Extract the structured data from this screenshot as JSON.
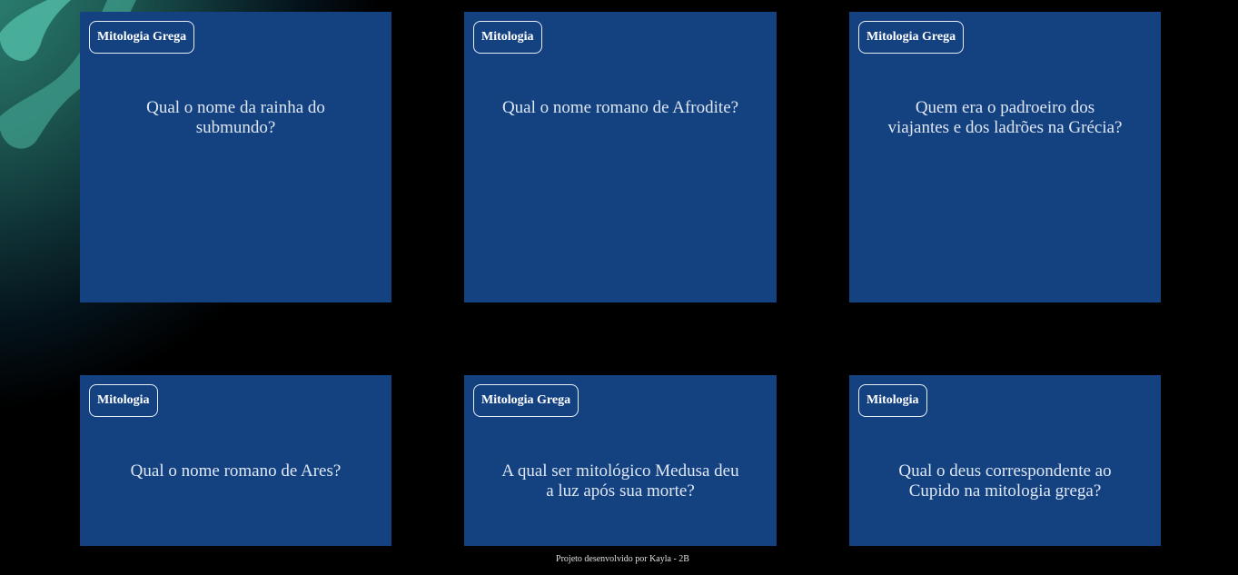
{
  "cards": [
    {
      "tag": "Mitologia Grega",
      "question": "Qual o nome da rainha do submundo?"
    },
    {
      "tag": "Mitologia",
      "question": "Qual o nome romano de Afrodite?"
    },
    {
      "tag": "Mitologia Grega",
      "question": "Quem era o padroeiro dos viajantes e dos ladrões na Grécia?"
    },
    {
      "tag": "Mitologia",
      "question": "Qual o nome romano de Ares?"
    },
    {
      "tag": "Mitologia Grega",
      "question": "A qual ser mitológico Medusa deu a luz após sua morte?"
    },
    {
      "tag": "Mitologia",
      "question": "Qual o deus correspondente ao Cupido na mitologia grega?"
    }
  ],
  "footer": {
    "text": "Projeto desenvolvido por Kayla - 2B"
  },
  "colors": {
    "background": "#000000",
    "card": "#144281",
    "glow": "#2f8b7b"
  }
}
